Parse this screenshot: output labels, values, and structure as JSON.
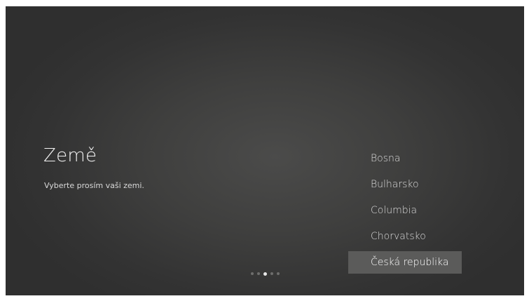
{
  "page": {
    "title": "Země",
    "subtitle": "Vyberte prosím vaši zemi."
  },
  "countries": [
    {
      "label": "Bosna",
      "selected": false
    },
    {
      "label": "Bulharsko",
      "selected": false
    },
    {
      "label": "Columbia",
      "selected": false
    },
    {
      "label": "Chorvatsko",
      "selected": false
    },
    {
      "label": "Česká republika",
      "selected": true
    }
  ],
  "pagination": {
    "total": 5,
    "current": 3
  },
  "colors": {
    "background": "#3f3f3e",
    "selected_bg": "#5b5b5a",
    "text": "#dcdcdc"
  }
}
